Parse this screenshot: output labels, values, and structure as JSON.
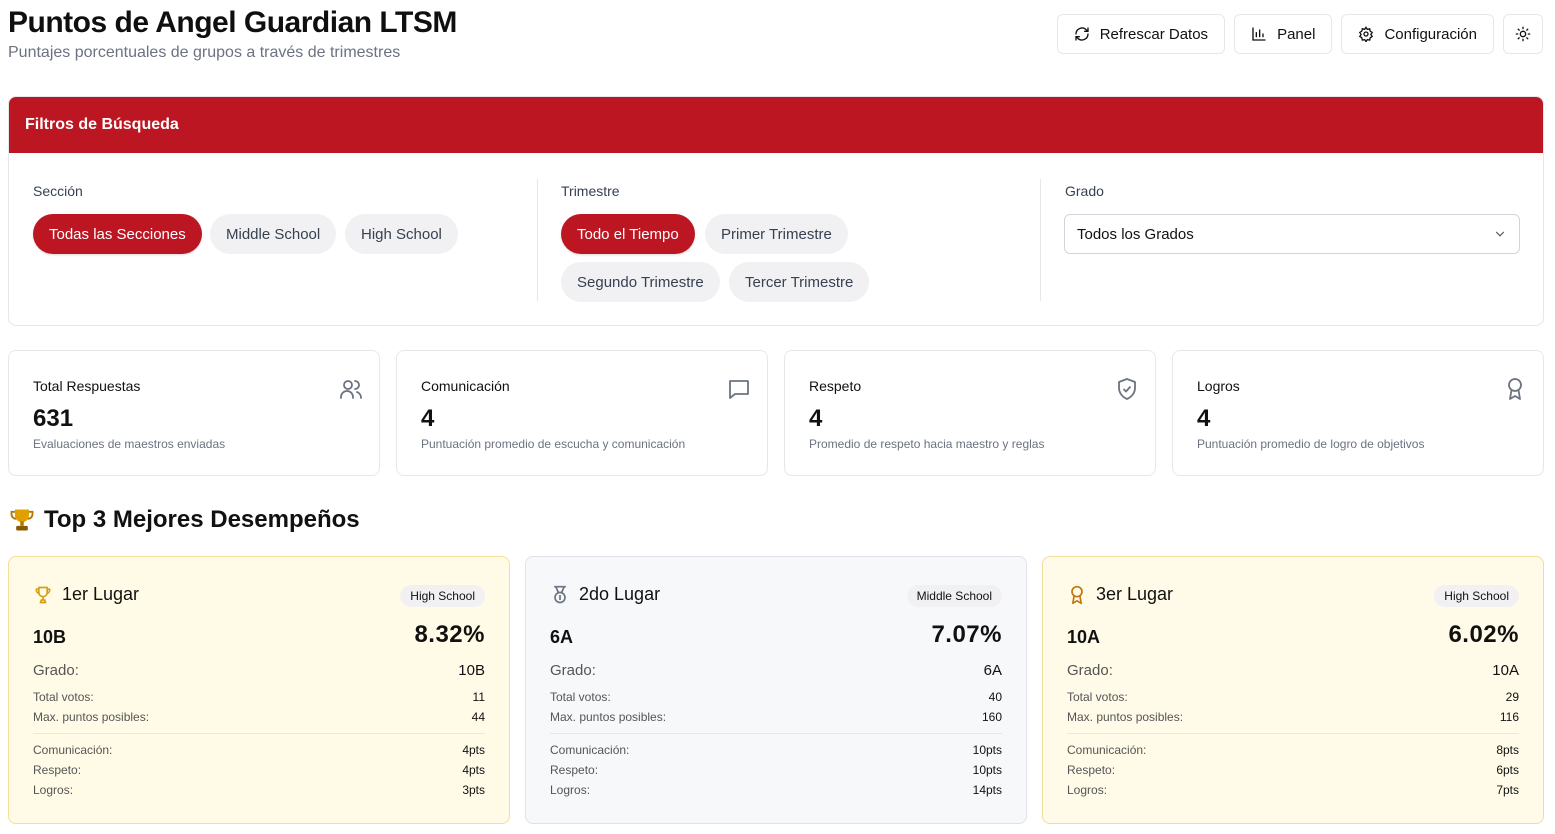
{
  "header": {
    "title": "Puntos de Angel Guardian LTSM",
    "subtitle": "Puntajes porcentuales de grupos a través de trimestres",
    "refresh_label": "Refrescar Datos",
    "panel_label": "Panel",
    "config_label": "Configuración"
  },
  "filters": {
    "title": "Filtros de Búsqueda",
    "section_label": "Sección",
    "sections": [
      "Todas las Secciones",
      "Middle School",
      "High School"
    ],
    "trimester_label": "Trimestre",
    "trimesters": [
      "Todo el Tiempo",
      "Primer Trimestre",
      "Segundo Trimestre",
      "Tercer Trimestre"
    ],
    "grade_label": "Grado",
    "grade_value": "Todos los Grados"
  },
  "stats": [
    {
      "title": "Total Respuestas",
      "value": "631",
      "desc": "Evaluaciones de maestros enviadas",
      "icon": "users-icon"
    },
    {
      "title": "Comunicación",
      "value": "4",
      "desc": "Puntuación promedio de escucha y comunicación",
      "icon": "message-icon"
    },
    {
      "title": "Respeto",
      "value": "4",
      "desc": "Promedio de respeto hacia maestro y reglas",
      "icon": "shield-check-icon"
    },
    {
      "title": "Logros",
      "value": "4",
      "desc": "Puntuación promedio de logro de objetivos",
      "icon": "award-icon"
    }
  ],
  "top": {
    "title": "Top 3 Mejores Desempeños",
    "labels": {
      "grade": "Grado:",
      "votes": "Total votos:",
      "max": "Max. puntos posibles:",
      "comm": "Comunicación:",
      "respect": "Respeto:",
      "achieve": "Logros:"
    },
    "cards": [
      {
        "place": "1er Lugar",
        "badge": "High School",
        "group": "10B",
        "pct": "8.32%",
        "grade": "10B",
        "votes": "11",
        "max": "44",
        "comm": "4pts",
        "respect": "4pts",
        "achieve": "3pts"
      },
      {
        "place": "2do Lugar",
        "badge": "Middle School",
        "group": "6A",
        "pct": "7.07%",
        "grade": "6A",
        "votes": "40",
        "max": "160",
        "comm": "10pts",
        "respect": "10pts",
        "achieve": "14pts"
      },
      {
        "place": "3er Lugar",
        "badge": "High School",
        "group": "10A",
        "pct": "6.02%",
        "grade": "10A",
        "votes": "29",
        "max": "116",
        "comm": "8pts",
        "respect": "6pts",
        "achieve": "7pts"
      }
    ]
  },
  "colors": {
    "accent": "#bc1622",
    "gold": "#d4a017",
    "silver": "#6b7280",
    "bronze": "#c2760c"
  }
}
